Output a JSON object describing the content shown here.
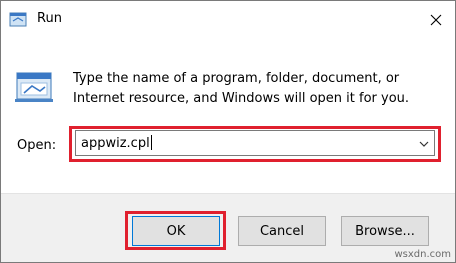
{
  "window": {
    "title": "Run",
    "close_icon": "close-icon",
    "app_icon": "run-app-icon"
  },
  "content": {
    "icon": "run-program-icon",
    "description": "Type the name of a program, folder, document, or Internet resource, and Windows will open it for you.",
    "open_label": "Open:",
    "open_value": "appwiz.cpl",
    "dropdown_icon": "chevron-down-icon"
  },
  "buttons": {
    "ok": "OK",
    "cancel": "Cancel",
    "browse": "Browse..."
  },
  "highlight_color": "#e0202e",
  "watermark": "wsxdn.com"
}
